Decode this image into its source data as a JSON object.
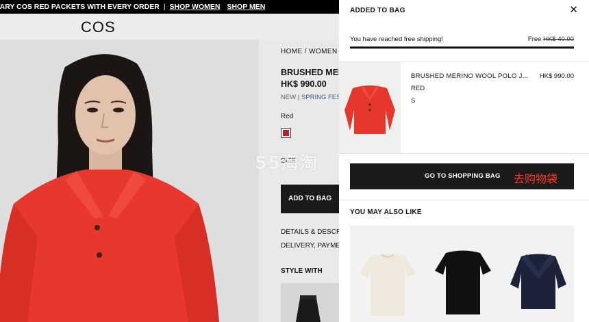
{
  "promo": {
    "message": "TARY COS RED PACKETS WITH EVERY ORDER",
    "separator": "|",
    "shop_women": "SHOP WOMEN",
    "shop_men": "SHOP MEN"
  },
  "header": {
    "logo": "COS"
  },
  "product": {
    "breadcrumb": "HOME / WOMEN",
    "title": "BRUSHED MERINO WOOL POLO JUMPER",
    "price": "HK$ 990.00",
    "tag_new": "NEW",
    "tag_sep": "|",
    "tag_collection": "SPRING FESTIVAL",
    "color_label": "Red",
    "size_label": "SIZE",
    "add_to_bag": "ADD TO BAG",
    "details_link": "DETAILS & DESCRIPTION",
    "delivery_link": "DELIVERY, PAYMENT",
    "style_with": "STYLE WITH",
    "swatch_color": "#b3261e"
  },
  "drawer": {
    "title": "ADDED TO BAG",
    "close_icon": "close-icon",
    "shipping_message": "You have reached free shipping!",
    "shipping_free": "Free",
    "shipping_old_price": "HK$ 40.00",
    "shipping_progress": 1.0,
    "item": {
      "name": "BRUSHED MERINO WOOL POLO J...",
      "price": "HK$ 990.00",
      "color": "RED",
      "size": "S"
    },
    "go_button": "GO TO SHOPPING BAG",
    "go_button_cn": "去购物袋",
    "you_may_also_like": "YOU MAY ALSO LIKE"
  },
  "watermark": "55海淘"
}
